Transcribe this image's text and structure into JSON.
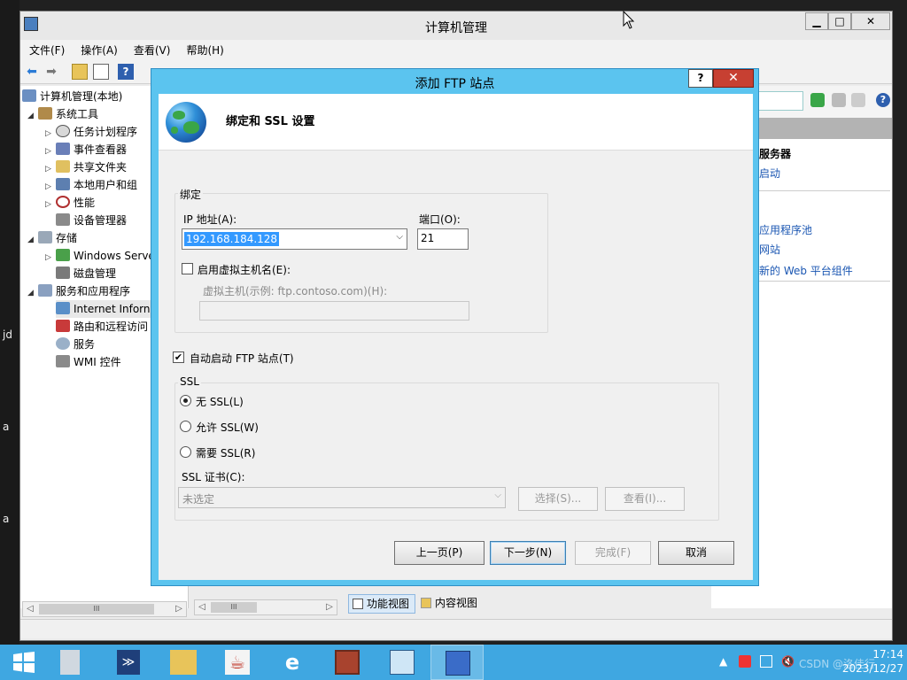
{
  "desktop": {
    "left_labels": [
      "jd",
      "a",
      "a"
    ]
  },
  "mmc": {
    "title": "计算机管理",
    "controls": {
      "minimize": "▁",
      "maximize": "□",
      "close": "✕"
    },
    "menu": [
      "文件(F)",
      "操作(A)",
      "查看(V)",
      "帮助(H)"
    ],
    "tree": [
      {
        "label": "计算机管理(本地)",
        "level": 0,
        "arrow": "",
        "icon": "computer-icon"
      },
      {
        "label": "系统工具",
        "level": 1,
        "arrow": "◢",
        "icon": "tools-icon"
      },
      {
        "label": "任务计划程序",
        "level": 2,
        "arrow": "▷",
        "icon": "clock-icon"
      },
      {
        "label": "事件查看器",
        "level": 2,
        "arrow": "▷",
        "icon": "event-viewer-icon"
      },
      {
        "label": "共享文件夹",
        "level": 2,
        "arrow": "▷",
        "icon": "shared-folder-icon"
      },
      {
        "label": "本地用户和组",
        "level": 2,
        "arrow": "▷",
        "icon": "users-icon"
      },
      {
        "label": "性能",
        "level": 2,
        "arrow": "▷",
        "icon": "performance-icon"
      },
      {
        "label": "设备管理器",
        "level": 2,
        "arrow": "",
        "icon": "device-manager-icon"
      },
      {
        "label": "存储",
        "level": 1,
        "arrow": "◢",
        "icon": "storage-icon"
      },
      {
        "label": "Windows Serve",
        "level": 2,
        "arrow": "▷",
        "icon": "backup-icon"
      },
      {
        "label": "磁盘管理",
        "level": 2,
        "arrow": "",
        "icon": "disk-icon"
      },
      {
        "label": "服务和应用程序",
        "level": 1,
        "arrow": "◢",
        "icon": "services-apps-icon"
      },
      {
        "label": "Internet Inforn",
        "level": 2,
        "arrow": "",
        "icon": "iis-icon"
      },
      {
        "label": "路由和远程访问",
        "level": 2,
        "arrow": "",
        "icon": "routing-icon"
      },
      {
        "label": "服务",
        "level": 2,
        "arrow": "",
        "icon": "gear-icon"
      },
      {
        "label": "WMI 控件",
        "level": 2,
        "arrow": "",
        "icon": "wmi-icon"
      }
    ],
    "actions": {
      "section_header": "服务器",
      "items": [
        "启动",
        "应用程序池",
        "网站",
        "新的 Web 平台组件"
      ]
    },
    "bottom_tabs": {
      "feature_view": "功能视图",
      "content_view": "内容视图"
    },
    "scroll_thumb": "III"
  },
  "dialog": {
    "title": "添加 FTP 站点",
    "help": "?",
    "close": "✕",
    "heading": "绑定和 SSL 设置",
    "binding": {
      "legend": "绑定",
      "ip_label": "IP 地址(A):",
      "ip_value": "192.168.184.128",
      "port_label": "端口(O):",
      "port_value": "21",
      "vhost_checkbox_label": "启用虚拟主机名(E):",
      "vhost_checked": false,
      "vhost_field_label": "虚拟主机(示例: ftp.contoso.com)(H):",
      "vhost_value": ""
    },
    "autostart_label": "自动启动 FTP 站点(T)",
    "autostart_checked": true,
    "ssl": {
      "legend": "SSL",
      "options": [
        "无 SSL(L)",
        "允许 SSL(W)",
        "需要 SSL(R)"
      ],
      "selected_index": 0,
      "cert_label": "SSL 证书(C):",
      "cert_value": "未选定",
      "select_button": "选择(S)...",
      "view_button": "查看(I)..."
    },
    "buttons": {
      "prev": "上一页(P)",
      "next": "下一步(N)",
      "finish": "完成(F)",
      "cancel": "取消"
    }
  },
  "taskbar": {
    "items": [
      "start-icon",
      "server-manager-icon",
      "powershell-icon",
      "file-explorer-icon",
      "java-icon",
      "internet-explorer-icon",
      "firewall-icon",
      "control-panel-icon",
      "computer-management-icon"
    ],
    "active_index": 8,
    "time": "17:14",
    "date": "2023/12/27",
    "watermark": "CSDN @洛佳行"
  },
  "colors": {
    "dialog_frame": "#5bc4ef",
    "close_red": "#c74032",
    "taskbar": "#3fa7e1",
    "selection": "#3399ff",
    "link": "#1a56b2"
  }
}
